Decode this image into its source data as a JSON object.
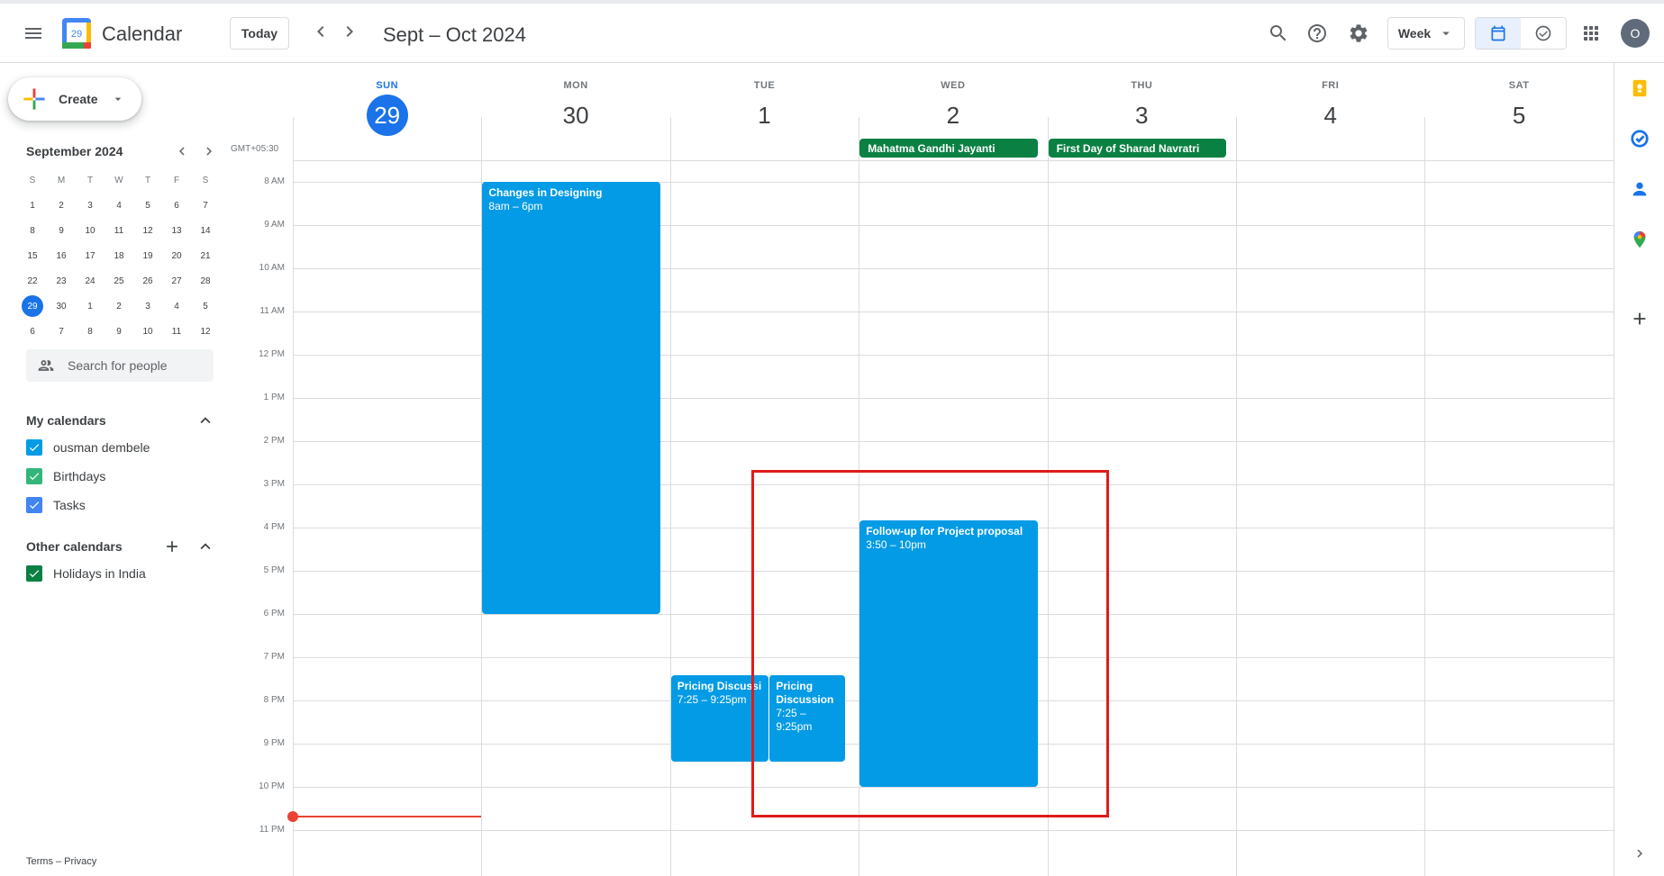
{
  "header": {
    "app_name": "Calendar",
    "logo_day": "29",
    "today_label": "Today",
    "date_range": "Sept – Oct 2024",
    "view_label": "Week",
    "avatar_initial": "O"
  },
  "sidebar": {
    "create_label": "Create",
    "mini_calendar": {
      "month": "September 2024",
      "weekday_initials": [
        "S",
        "M",
        "T",
        "W",
        "T",
        "F",
        "S"
      ],
      "weeks": [
        [
          "1",
          "2",
          "3",
          "4",
          "5",
          "6",
          "7"
        ],
        [
          "8",
          "9",
          "10",
          "11",
          "12",
          "13",
          "14"
        ],
        [
          "15",
          "16",
          "17",
          "18",
          "19",
          "20",
          "21"
        ],
        [
          "22",
          "23",
          "24",
          "25",
          "26",
          "27",
          "28"
        ],
        [
          "29",
          "30",
          "1",
          "2",
          "3",
          "4",
          "5"
        ],
        [
          "6",
          "7",
          "8",
          "9",
          "10",
          "11",
          "12"
        ]
      ],
      "selected_day": "29"
    },
    "search_people_placeholder": "Search for people",
    "my_calendars": {
      "title": "My calendars",
      "items": [
        {
          "label": "ousman dembele",
          "color": "#039be5"
        },
        {
          "label": "Birthdays",
          "color": "#33b679"
        },
        {
          "label": "Tasks",
          "color": "#4285f4"
        }
      ]
    },
    "other_calendars": {
      "title": "Other calendars",
      "items": [
        {
          "label": "Holidays in India",
          "color": "#0b8043"
        }
      ]
    },
    "footer": "Terms – Privacy"
  },
  "week": {
    "timezone": "GMT+05:30",
    "days": [
      {
        "dow": "SUN",
        "num": "29",
        "current": true
      },
      {
        "dow": "MON",
        "num": "30",
        "current": false
      },
      {
        "dow": "TUE",
        "num": "1",
        "current": false
      },
      {
        "dow": "WED",
        "num": "2",
        "current": false
      },
      {
        "dow": "THU",
        "num": "3",
        "current": false
      },
      {
        "dow": "FRI",
        "num": "4",
        "current": false
      },
      {
        "dow": "SAT",
        "num": "5",
        "current": false
      }
    ],
    "hours": [
      "8 AM",
      "9 AM",
      "10 AM",
      "11 AM",
      "12 PM",
      "1 PM",
      "2 PM",
      "3 PM",
      "4 PM",
      "5 PM",
      "6 PM",
      "7 PM",
      "8 PM",
      "9 PM",
      "10 PM",
      "11 PM"
    ],
    "all_day_events": [
      {
        "title": "Mahatma Gandhi Jayanti",
        "day": "WED"
      },
      {
        "title": "First Day of Sharad Navratri",
        "day": "THU"
      }
    ],
    "events": [
      {
        "title": "Changes in Designing",
        "time": "8am – 6pm",
        "day": "MON"
      },
      {
        "title": "Pricing Discussion",
        "display_title": "Pricing Discussi",
        "time": "7:25 – 9:25pm",
        "day": "TUE"
      },
      {
        "title": "Pricing Discussion",
        "time": "7:25 – 9:25pm",
        "day": "TUE"
      },
      {
        "title": "Follow-up for Project proposal",
        "time": "3:50 – 10pm",
        "day": "WED"
      }
    ]
  },
  "colors": {
    "accent": "#1a73e8",
    "event": "#039be5",
    "holiday": "#0b8043",
    "now_line": "#ea4335",
    "highlight": "#e01b1b"
  }
}
